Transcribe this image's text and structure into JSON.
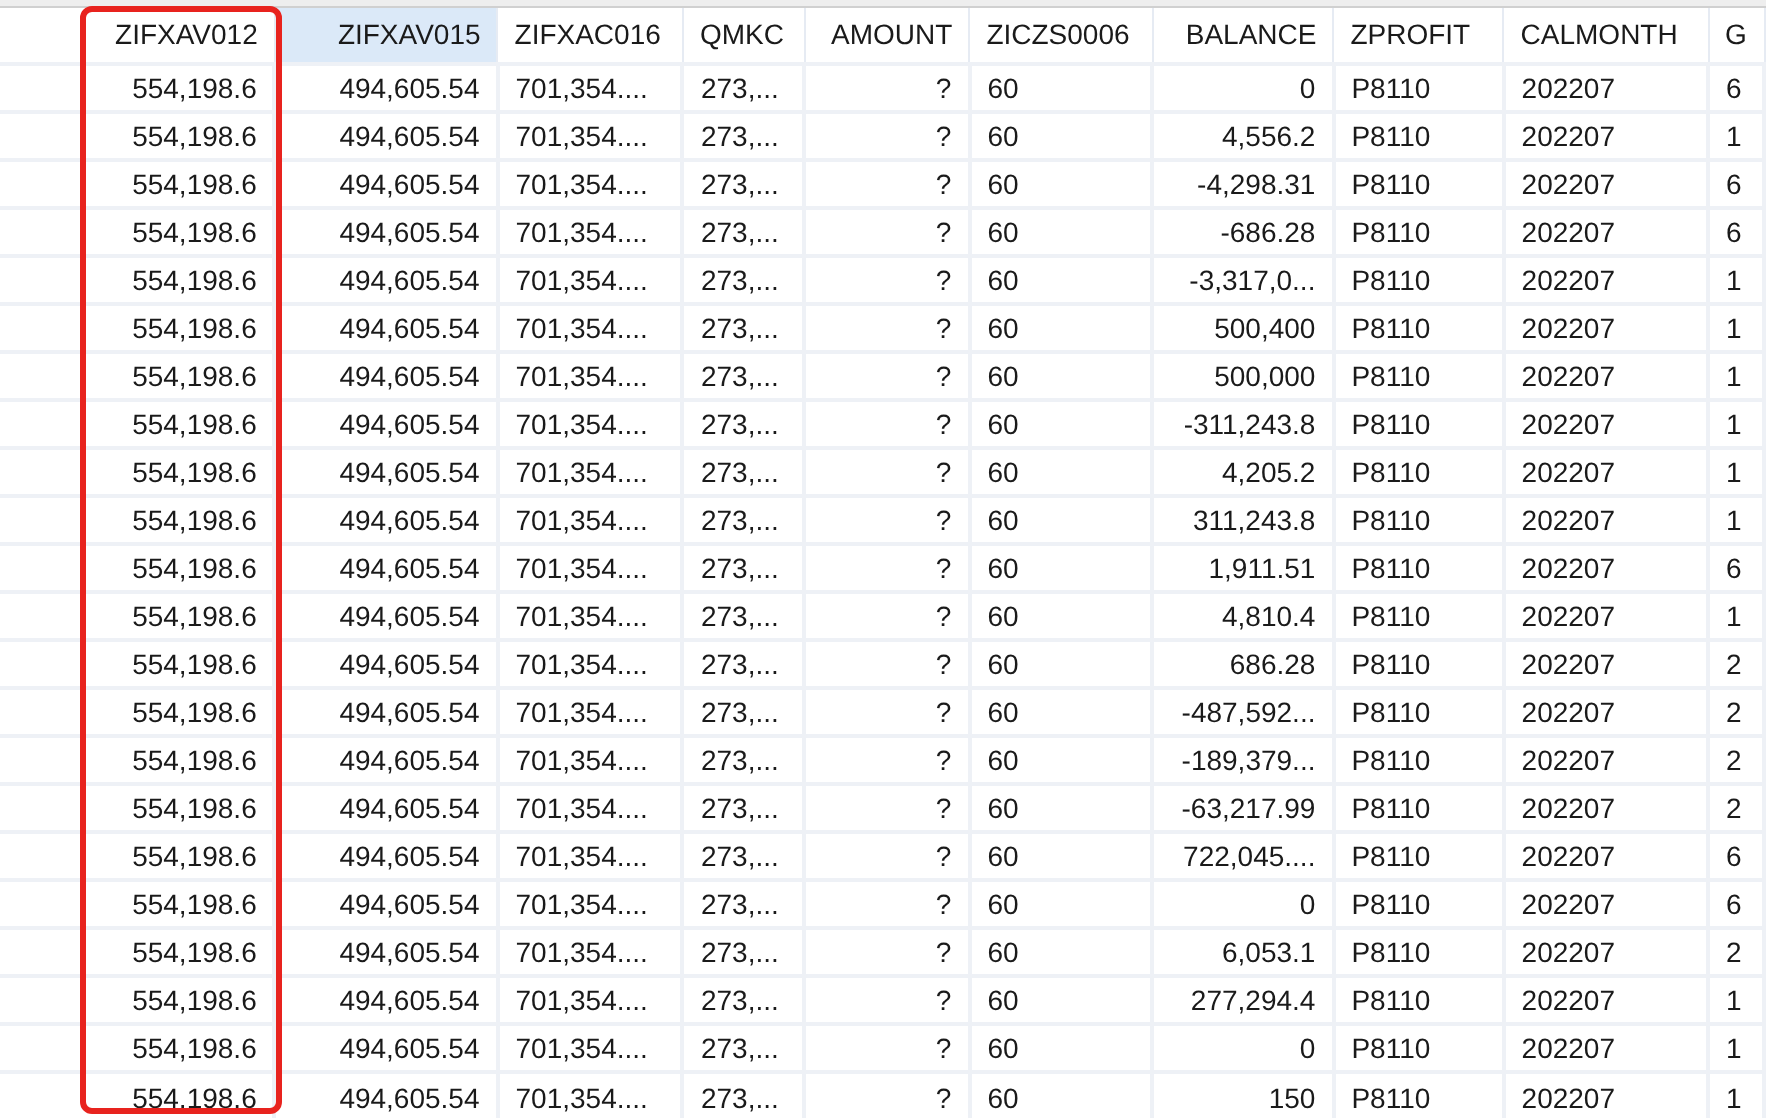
{
  "table": {
    "columns": [
      {
        "label": "ZIFXAV012",
        "kind": "number",
        "selected": false
      },
      {
        "label": "ZIFXAV015",
        "kind": "number",
        "selected": true
      },
      {
        "label": "ZIFXAC016",
        "kind": "text",
        "selected": false
      },
      {
        "label": "QMKC",
        "kind": "text",
        "selected": false
      },
      {
        "label": "AMOUNT",
        "kind": "number",
        "selected": false
      },
      {
        "label": "ZICZS0006",
        "kind": "text",
        "selected": false
      },
      {
        "label": "BALANCE",
        "kind": "number",
        "selected": false
      },
      {
        "label": "ZPROFIT",
        "kind": "text",
        "selected": false
      },
      {
        "label": "CALMONTH",
        "kind": "text",
        "selected": false
      },
      {
        "label": "G",
        "kind": "text",
        "selected": false
      }
    ],
    "rows": [
      [
        "554,198.6",
        "494,605.54",
        "701,354....",
        "273,...",
        "?",
        "60",
        "0",
        "P8110",
        "202207",
        "6"
      ],
      [
        "554,198.6",
        "494,605.54",
        "701,354....",
        "273,...",
        "?",
        "60",
        "4,556.2",
        "P8110",
        "202207",
        "1"
      ],
      [
        "554,198.6",
        "494,605.54",
        "701,354....",
        "273,...",
        "?",
        "60",
        "-4,298.31",
        "P8110",
        "202207",
        "6"
      ],
      [
        "554,198.6",
        "494,605.54",
        "701,354....",
        "273,...",
        "?",
        "60",
        "-686.28",
        "P8110",
        "202207",
        "6"
      ],
      [
        "554,198.6",
        "494,605.54",
        "701,354....",
        "273,...",
        "?",
        "60",
        "-3,317,0...",
        "P8110",
        "202207",
        "1"
      ],
      [
        "554,198.6",
        "494,605.54",
        "701,354....",
        "273,...",
        "?",
        "60",
        "500,400",
        "P8110",
        "202207",
        "1"
      ],
      [
        "554,198.6",
        "494,605.54",
        "701,354....",
        "273,...",
        "?",
        "60",
        "500,000",
        "P8110",
        "202207",
        "1"
      ],
      [
        "554,198.6",
        "494,605.54",
        "701,354....",
        "273,...",
        "?",
        "60",
        "-311,243.8",
        "P8110",
        "202207",
        "1"
      ],
      [
        "554,198.6",
        "494,605.54",
        "701,354....",
        "273,...",
        "?",
        "60",
        "4,205.2",
        "P8110",
        "202207",
        "1"
      ],
      [
        "554,198.6",
        "494,605.54",
        "701,354....",
        "273,...",
        "?",
        "60",
        "311,243.8",
        "P8110",
        "202207",
        "1"
      ],
      [
        "554,198.6",
        "494,605.54",
        "701,354....",
        "273,...",
        "?",
        "60",
        "1,911.51",
        "P8110",
        "202207",
        "6"
      ],
      [
        "554,198.6",
        "494,605.54",
        "701,354....",
        "273,...",
        "?",
        "60",
        "4,810.4",
        "P8110",
        "202207",
        "1"
      ],
      [
        "554,198.6",
        "494,605.54",
        "701,354....",
        "273,...",
        "?",
        "60",
        "686.28",
        "P8110",
        "202207",
        "2"
      ],
      [
        "554,198.6",
        "494,605.54",
        "701,354....",
        "273,...",
        "?",
        "60",
        "-487,592...",
        "P8110",
        "202207",
        "2"
      ],
      [
        "554,198.6",
        "494,605.54",
        "701,354....",
        "273,...",
        "?",
        "60",
        "-189,379...",
        "P8110",
        "202207",
        "2"
      ],
      [
        "554,198.6",
        "494,605.54",
        "701,354....",
        "273,...",
        "?",
        "60",
        "-63,217.99",
        "P8110",
        "202207",
        "2"
      ],
      [
        "554,198.6",
        "494,605.54",
        "701,354....",
        "273,...",
        "?",
        "60",
        "722,045....",
        "P8110",
        "202207",
        "6"
      ],
      [
        "554,198.6",
        "494,605.54",
        "701,354....",
        "273,...",
        "?",
        "60",
        "0",
        "P8110",
        "202207",
        "6"
      ],
      [
        "554,198.6",
        "494,605.54",
        "701,354....",
        "273,...",
        "?",
        "60",
        "6,053.1",
        "P8110",
        "202207",
        "2"
      ],
      [
        "554,198.6",
        "494,605.54",
        "701,354....",
        "273,...",
        "?",
        "60",
        "277,294.4",
        "P8110",
        "202207",
        "1"
      ],
      [
        "554,198.6",
        "494,605.54",
        "701,354....",
        "273,...",
        "?",
        "60",
        "0",
        "P8110",
        "202207",
        "1"
      ],
      [
        "554,198.6",
        "494,605.54",
        "701,354....",
        "273,...",
        "?",
        "60",
        "150",
        "P8110",
        "202207",
        "1"
      ]
    ]
  }
}
